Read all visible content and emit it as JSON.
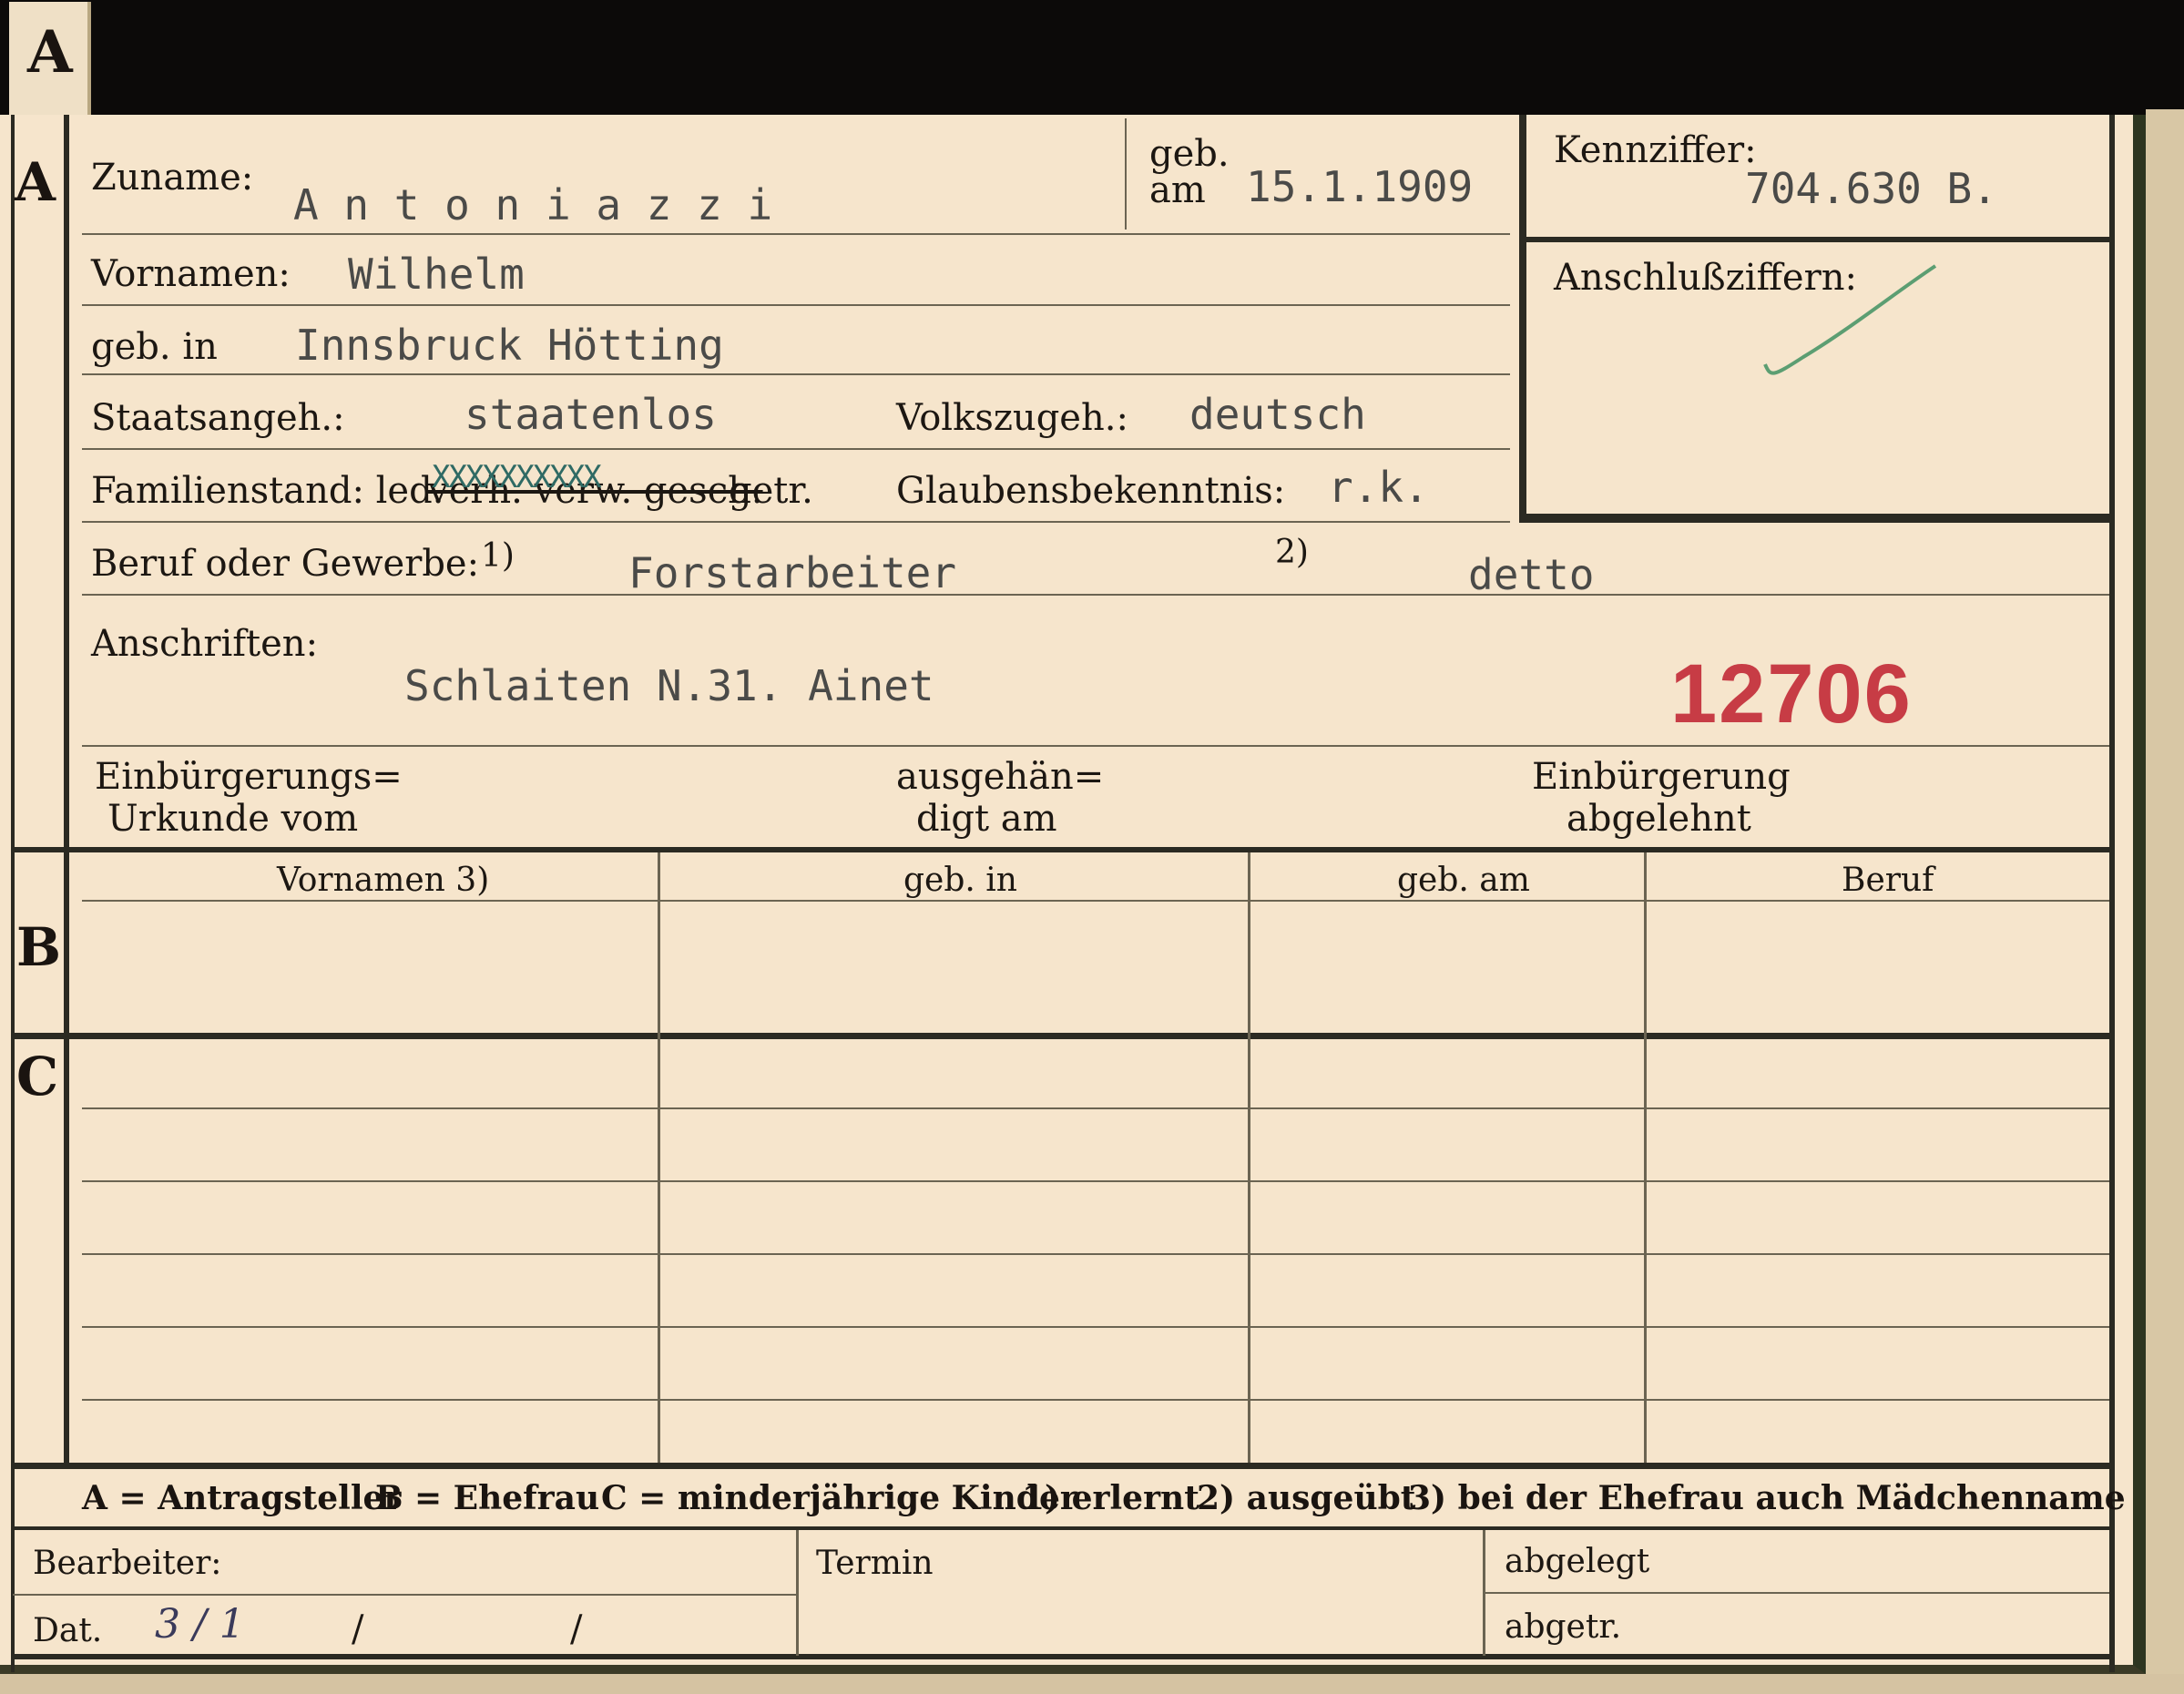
{
  "tab_letter": "A",
  "section_a": {
    "marker": "A",
    "zuname_label": "Zuname:",
    "zuname_value": "A n t o n i a z z i",
    "geb_label": "geb.",
    "am_label": "am",
    "geb_am_value": "15.1.1909",
    "kennziffer_label": "Kennziffer:",
    "kennziffer_value": "704.630   B.",
    "anschlussziffern_label": "Anschlußziffern:",
    "vornamen_label": "Vornamen:",
    "vornamen_value": "Wilhelm",
    "geb_in_label": "geb. in",
    "geb_in_value": "Innsbruck Hötting",
    "staatsangeh_label": "Staatsangeh.:",
    "staatsangeh_value": "staatenlos",
    "volkszugeh_label": "Volkszugeh.:",
    "volkszugeh_value": "deutsch",
    "familienstand_label": "Familienstand: led.",
    "familienstand_struck": "verh. verw. gesch.",
    "familienstand_x": "XXXXXXXXXX",
    "familienstand_end": "getr.",
    "glaubens_label": "Glaubensbekenntnis:",
    "glaubens_value": "r.k.",
    "beruf_label": "Beruf oder Gewerbe:",
    "fn1": "1)",
    "beruf_value1": "Forstarbeiter",
    "fn2": "2)",
    "beruf_value2": "detto",
    "anschriften_label": "Anschriften:",
    "anschriften_value": "Schlaiten  N.31. Ainet",
    "stamp_number": "12706",
    "einb_urkunde_line1": "Einbürgerungs=",
    "einb_urkunde_line2": "Urkunde vom",
    "ausgehaendigt_line1": "ausgehän=",
    "ausgehaendigt_line2": "digt am",
    "einb_abgelehnt_line1": "Einbürgerung",
    "einb_abgelehnt_line2": "abgelehnt"
  },
  "section_b": {
    "marker": "B",
    "columns": [
      "Vornamen 3)",
      "geb. in",
      "geb. am",
      "Beruf"
    ]
  },
  "section_c": {
    "marker": "C"
  },
  "legend": {
    "a": "A = Antragsteller",
    "b": "B = Ehefrau",
    "c": "C = minderjährige Kinder",
    "f1": "1) erlernt",
    "f2": "2) ausgeübt",
    "f3": "3) bei der Ehefrau auch Mädchenname"
  },
  "footer": {
    "bearbeiter_label": "Bearbeiter:",
    "dat_label": "Dat.",
    "dat_value": "3 / 1",
    "slash1": "/",
    "slash2": "/",
    "termin_label": "Termin",
    "abgelegt_label": "abgelegt",
    "abgetr_label": "abgetr."
  }
}
